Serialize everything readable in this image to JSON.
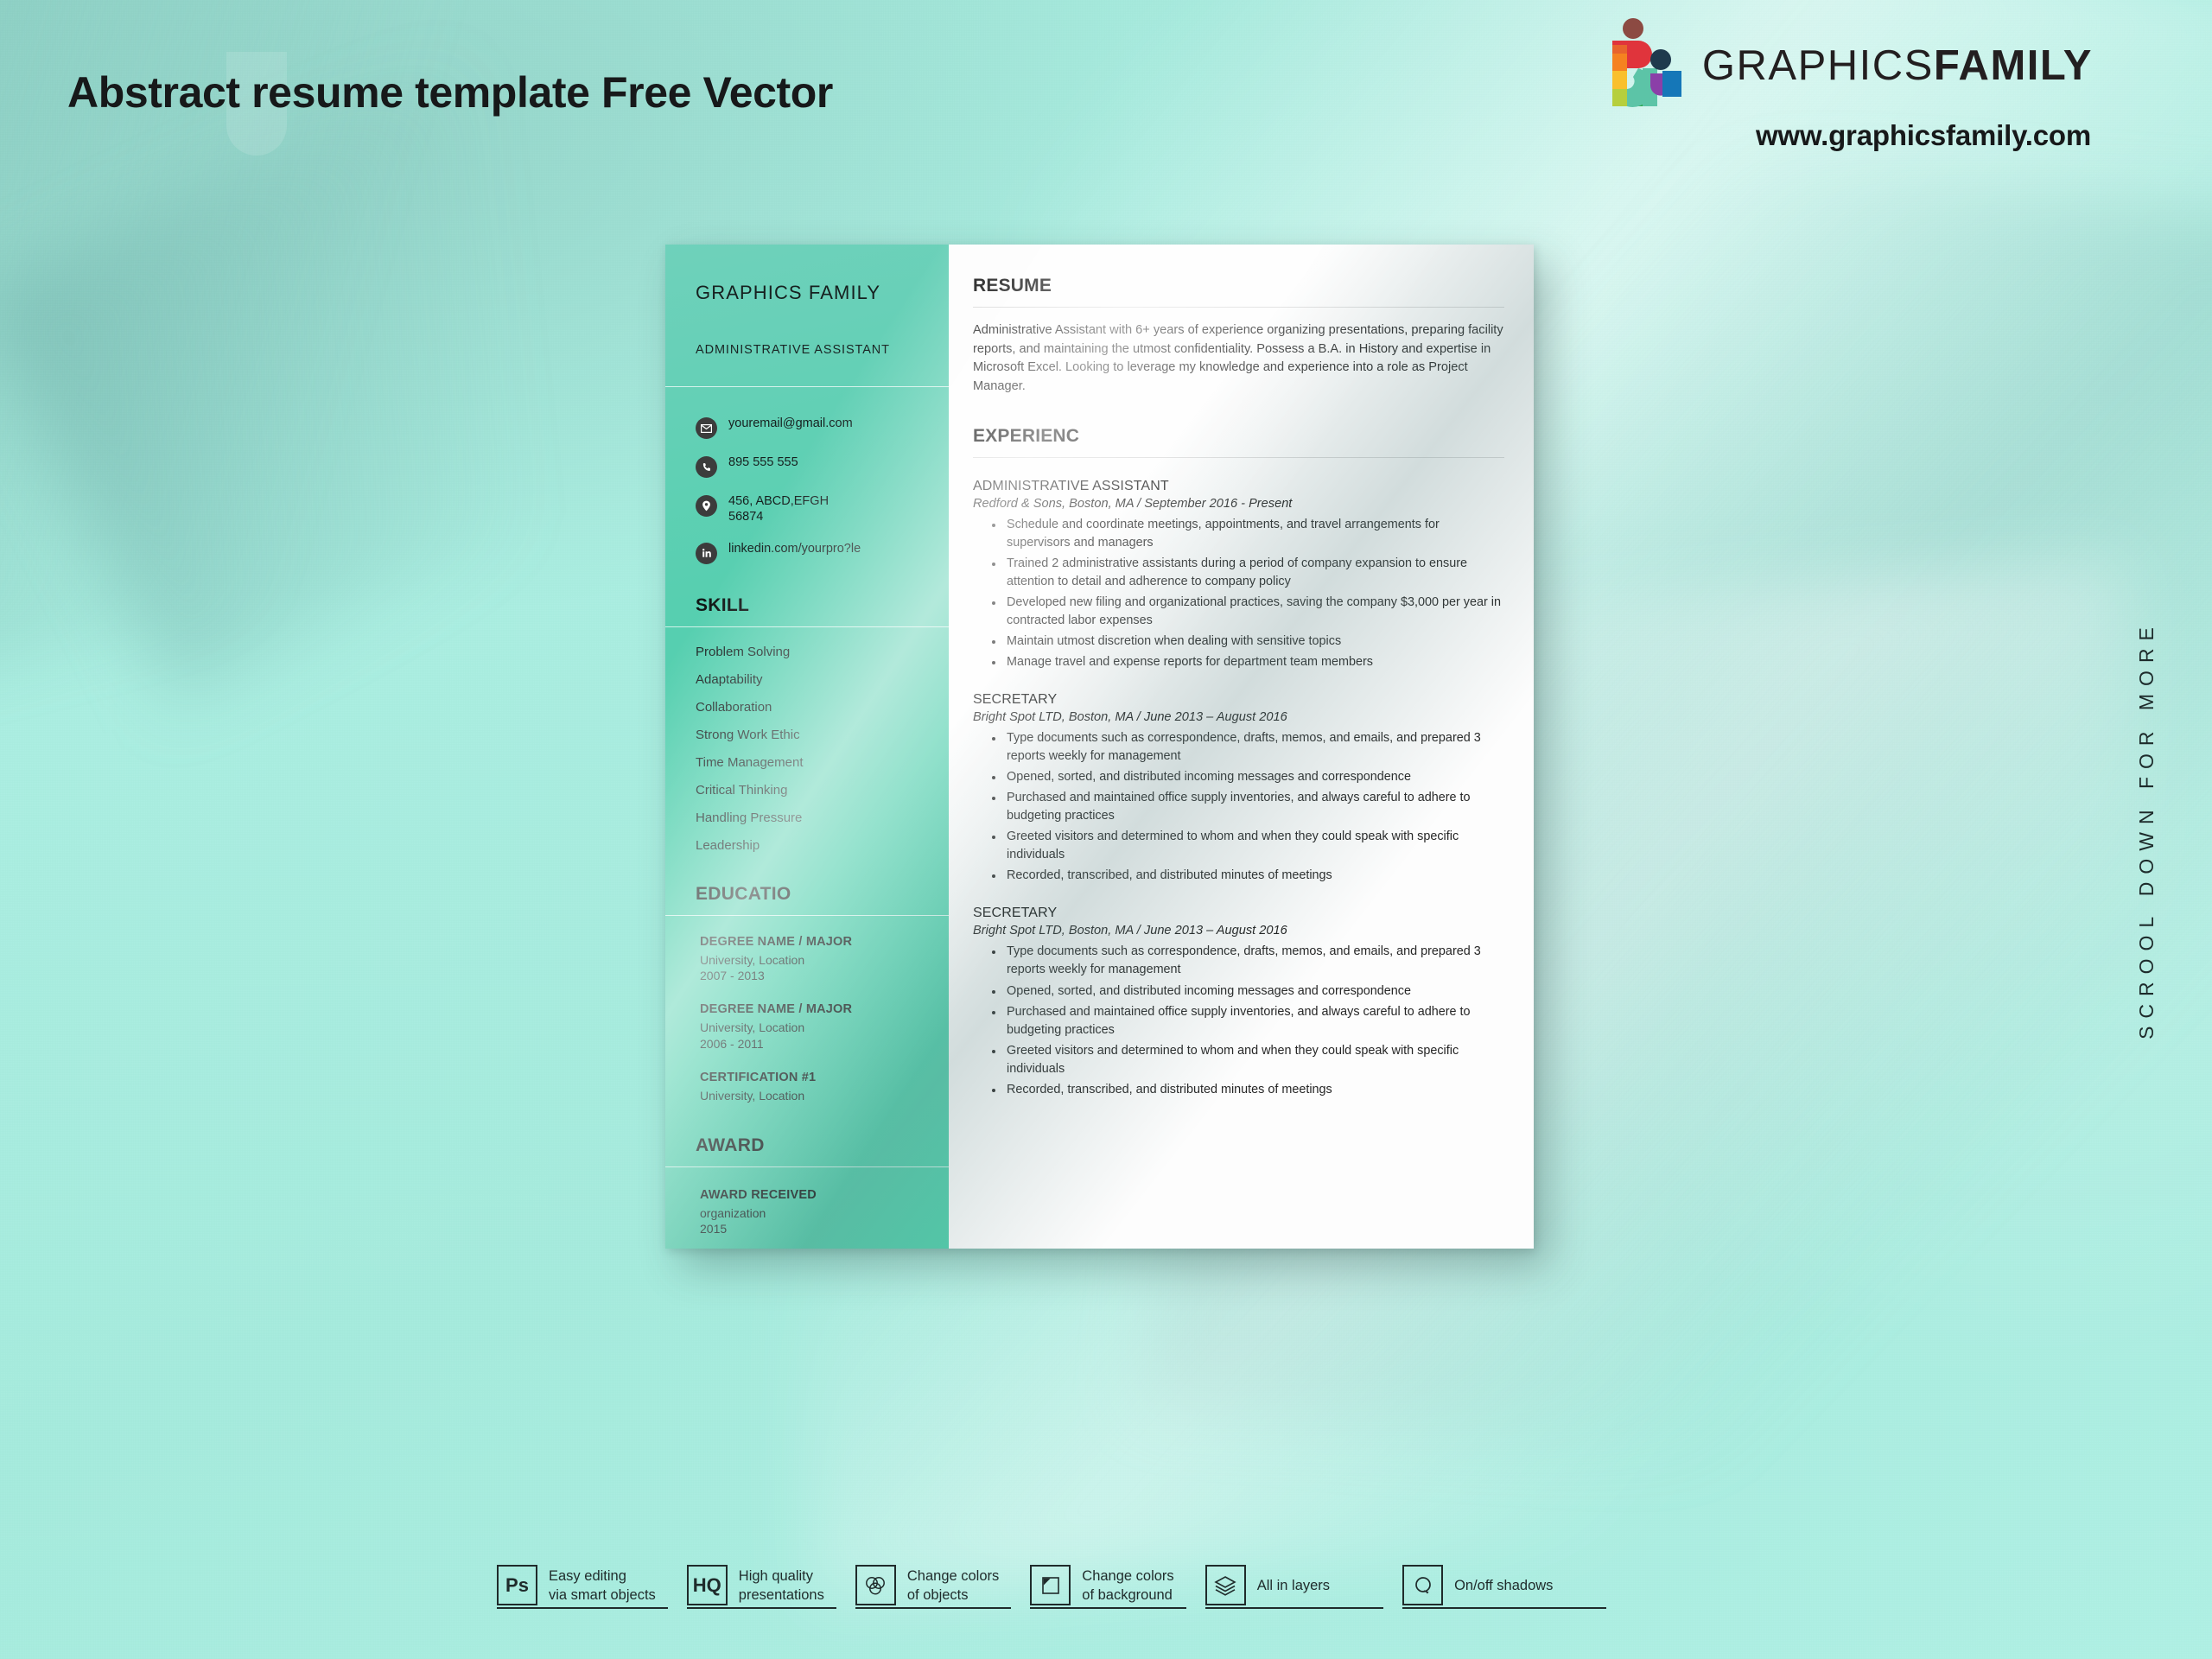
{
  "page": {
    "title": "Abstract resume template Free Vector",
    "scroll_note": "SCROOL DOWN FOR MORE",
    "background_color": "#a9ecdf",
    "accent_color": "#4ecfab"
  },
  "brand": {
    "name_thin": "GRAPHICS",
    "name_bold": "FAMILY",
    "url": "www.graphicsfamily.com",
    "mark_icon": "graphicsfamily-logo-icon"
  },
  "resume": {
    "sidebar": {
      "name": "GRAPHICS\nFAMILY",
      "role": "ADMINISTRATIVE ASSISTANT",
      "contacts": [
        {
          "icon": "email-icon",
          "text": "youremail@gmail.com"
        },
        {
          "icon": "phone-icon",
          "text": "895 555 555"
        },
        {
          "icon": "location-pin-icon",
          "text": "456, ABCD,EFGH\n56874"
        },
        {
          "icon": "linkedin-icon",
          "text": "linkedin.com/yourpro?le"
        }
      ],
      "skill_heading": "SKILL",
      "skills": [
        "Problem Solving",
        "Adaptability",
        "Collaboration",
        "Strong Work Ethic",
        "Time Management",
        "Critical Thinking",
        "Handling Pressure",
        "Leadership"
      ],
      "education_heading": "EDUCATIO",
      "education": [
        {
          "title": "DEGREE NAME / MAJOR",
          "place": "University, Location",
          "years": "2007 - 2013"
        },
        {
          "title": "DEGREE NAME / MAJOR",
          "place": "University, Location",
          "years": "2006 - 2011"
        },
        {
          "title": "CERTIFICATION #1",
          "place": "University, Location",
          "years": ""
        }
      ],
      "award_heading": "AWARD",
      "award": {
        "title": "AWARD RECEIVED",
        "organization": "organization",
        "year": "2015"
      }
    },
    "main": {
      "resume_heading": "RESUME",
      "summary": "Administrative Assistant with 6+ years of experience organizing presentations, preparing facility reports, and maintaining the utmost confidentiality. Possess a B.A. in History and expertise in Microsoft Excel. Looking to leverage my knowledge and experience into a role as Project Manager.",
      "experience_heading": "EXPERIENC",
      "experience": [
        {
          "role": "ADMINISTRATIVE ASSISTANT",
          "meta": "Redford & Sons, Boston, MA  /  September 2016 - Present",
          "bullets": [
            "Schedule and coordinate meetings, appointments, and travel arrangements for supervisors and managers",
            "Trained 2 administrative assistants during a period of company expansion to ensure attention to detail and adherence to company policy",
            "Developed new filing and organizational practices, saving the company $3,000 per year in contracted labor expenses",
            "Maintain utmost discretion when dealing with sensitive topics",
            "Manage travel and expense reports for department team members"
          ]
        },
        {
          "role": "SECRETARY",
          "meta": "Bright Spot LTD, Boston, MA  /  June 2013 – August 2016",
          "bullets": [
            "Type documents such as correspondence, drafts, memos, and emails, and prepared 3 reports weekly for management",
            "Opened, sorted, and distributed incoming messages and correspondence",
            "Purchased and maintained office supply inventories, and always careful to adhere to budgeting practices",
            "Greeted visitors and determined to whom and when they could speak with specific individuals",
            "Recorded, transcribed, and distributed minutes of meetings"
          ]
        },
        {
          "role": "SECRETARY",
          "meta": "Bright Spot LTD, Boston, MA  /  June 2013 – August 2016",
          "bullets": [
            "Type documents such as correspondence, drafts, memos, and emails, and prepared 3 reports weekly for management",
            "Opened, sorted, and distributed incoming messages and correspondence",
            "Purchased and maintained office supply inventories, and always careful to adhere to budgeting practices",
            "Greeted visitors and determined to whom and when they could speak with specific individuals",
            "Recorded, transcribed, and distributed minutes of meetings"
          ]
        }
      ]
    }
  },
  "features": [
    {
      "badge": "Ps",
      "icon": "photoshop-badge-icon",
      "label": "Easy editing\nvia smart objects"
    },
    {
      "badge": "HQ",
      "icon": "high-quality-badge-icon",
      "label": "High quality\npresentations"
    },
    {
      "badge": "",
      "icon": "color-circles-icon",
      "label": "Change colors\nof objects"
    },
    {
      "badge": "",
      "icon": "background-square-icon",
      "label": "Change colors\nof background"
    },
    {
      "badge": "",
      "icon": "layers-icon",
      "label": "All in layers"
    },
    {
      "badge": "",
      "icon": "shadow-toggle-icon",
      "label": "On/off shadows"
    }
  ]
}
